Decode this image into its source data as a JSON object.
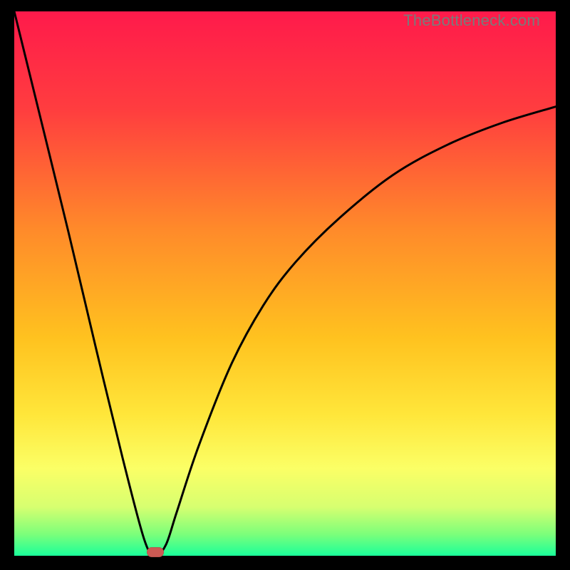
{
  "watermark": "TheBottleneck.com",
  "chart_data": {
    "type": "line",
    "title": "",
    "xlabel": "",
    "ylabel": "",
    "xlim": [
      0,
      100
    ],
    "ylim": [
      0,
      100
    ],
    "grid": false,
    "legend": false,
    "series": [
      {
        "name": "bottleneck-curve",
        "x": [
          0,
          5,
          10,
          15,
          20,
          24,
          26,
          28,
          30,
          34,
          40,
          46,
          52,
          60,
          70,
          80,
          90,
          100
        ],
        "y": [
          100,
          79.8,
          59.5,
          38.5,
          18.0,
          3.0,
          0.0,
          2.0,
          8.0,
          20.0,
          35.0,
          46.0,
          54.0,
          62.0,
          70.0,
          75.5,
          79.5,
          82.5
        ]
      }
    ],
    "marker": {
      "name": "optimal-point",
      "x": 26,
      "y": 0.7,
      "color": "#cc5a54"
    },
    "gradient_stops": [
      {
        "offset": 0,
        "color": "#ff1a4b"
      },
      {
        "offset": 18,
        "color": "#ff3d3f"
      },
      {
        "offset": 40,
        "color": "#ff8a2a"
      },
      {
        "offset": 60,
        "color": "#ffc21f"
      },
      {
        "offset": 74,
        "color": "#ffe63a"
      },
      {
        "offset": 84,
        "color": "#fbff66"
      },
      {
        "offset": 91,
        "color": "#d7ff70"
      },
      {
        "offset": 96,
        "color": "#7dff7a"
      },
      {
        "offset": 100,
        "color": "#1aff9a"
      }
    ]
  }
}
